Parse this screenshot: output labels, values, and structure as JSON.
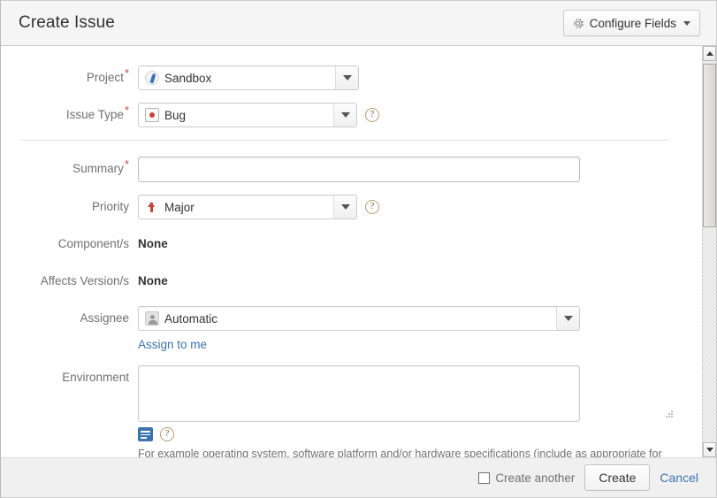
{
  "header": {
    "title": "Create Issue",
    "configure_fields_label": "Configure Fields",
    "gear_icon": "gear-icon",
    "caret_icon": "chevron-down-icon"
  },
  "form": {
    "project": {
      "label": "Project",
      "required": true,
      "value": "Sandbox",
      "icon": "project-rocket-icon"
    },
    "issue_type": {
      "label": "Issue Type",
      "required": true,
      "value": "Bug",
      "icon": "bug-icon",
      "help": "?"
    },
    "summary": {
      "label": "Summary",
      "required": true,
      "value": "",
      "placeholder": ""
    },
    "priority": {
      "label": "Priority",
      "required": false,
      "value": "Major",
      "icon": "priority-major-up-arrow-icon",
      "help": "?"
    },
    "components": {
      "label": "Component/s",
      "value": "None"
    },
    "affects_versions": {
      "label": "Affects Version/s",
      "value": "None"
    },
    "assignee": {
      "label": "Assignee",
      "value": "Automatic",
      "icon": "user-avatar-icon",
      "assign_to_me_label": "Assign to me"
    },
    "environment": {
      "label": "Environment",
      "value": "",
      "placeholder": "",
      "wiki_button": "wiki-markup-icon",
      "help": "?",
      "hint": "For example operating system, software platform and/or hardware specifications (include as appropriate for the issue)."
    }
  },
  "footer": {
    "create_another_label": "Create another",
    "create_another_checked": false,
    "create_label": "Create",
    "cancel_label": "Cancel"
  },
  "scrollbar": {
    "up_arrow": "scroll-up-arrow-icon",
    "down_arrow": "scroll-down-arrow-icon"
  },
  "colors": {
    "required_asterisk": "#d04437",
    "link": "#3b73af",
    "bug_red": "#d04437",
    "project_blue": "#3b73b9",
    "wiki_blue": "#3b73af"
  }
}
